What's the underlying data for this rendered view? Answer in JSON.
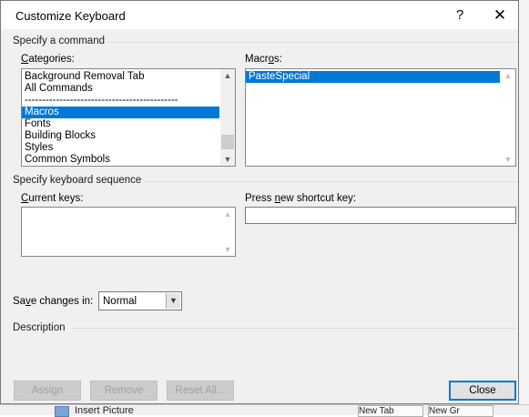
{
  "dialog": {
    "title": "Customize Keyboard",
    "help_glyph": "?",
    "close_glyph": "✕"
  },
  "specify_command": {
    "group_label": "Specify a command",
    "categories_label_pre": "",
    "categories_label_acc": "C",
    "categories_label_post": "ategories:",
    "categories": [
      {
        "label": "Background Removal Tab",
        "selected": false
      },
      {
        "label": "All Commands",
        "selected": false
      },
      {
        "label": "--------------------------------------------",
        "selected": false
      },
      {
        "label": "Macros",
        "selected": true
      },
      {
        "label": "Fonts",
        "selected": false
      },
      {
        "label": "Building Blocks",
        "selected": false
      },
      {
        "label": "Styles",
        "selected": false
      },
      {
        "label": "Common Symbols",
        "selected": false
      }
    ],
    "macros_label_pre": "Macr",
    "macros_label_acc": "o",
    "macros_label_post": "s:",
    "macros": [
      {
        "label": "PasteSpecial",
        "selected": true
      }
    ]
  },
  "keyboard_sequence": {
    "group_label": "Specify keyboard sequence",
    "current_keys_label_pre": "",
    "current_keys_label_acc": "C",
    "current_keys_label_post": "urrent keys:",
    "press_new_label_pre": "Press ",
    "press_new_label_acc": "n",
    "press_new_label_post": "ew shortcut key:",
    "press_new_value": ""
  },
  "save_changes": {
    "label_pre": "Sa",
    "label_acc": "v",
    "label_post": "e changes in:",
    "selected_value": "Normal"
  },
  "description": {
    "group_label": "Description"
  },
  "buttons": {
    "assign": "Assign",
    "remove": "Remove",
    "reset_all": "Reset All...",
    "close": "Close"
  },
  "background": {
    "insert_picture": "Insert Picture",
    "cell1": "New Tab",
    "cell2": "New Gr"
  }
}
